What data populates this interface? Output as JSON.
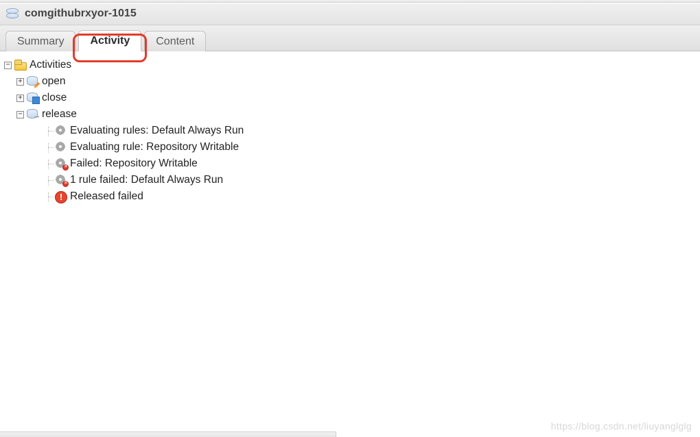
{
  "header": {
    "title": "comgithubrxyor-1015"
  },
  "tabs": {
    "summary": "Summary",
    "activity": "Activity",
    "content": "Content",
    "active": "activity"
  },
  "tree": {
    "root": "Activities",
    "open": "open",
    "close": "close",
    "release": "release",
    "release_items": {
      "eval_rules": "Evaluating rules: Default Always Run",
      "eval_rule_writable": "Evaluating rule: Repository Writable",
      "failed_writable": "Failed: Repository Writable",
      "one_rule_failed": "1 rule failed: Default Always Run",
      "released_failed": "Released failed"
    }
  },
  "watermark": "https://blog.csdn.net/liuyanglglg"
}
